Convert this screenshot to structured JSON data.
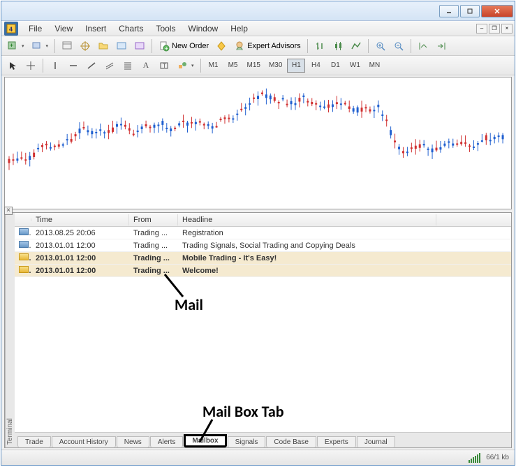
{
  "menu": {
    "items": [
      "File",
      "View",
      "Insert",
      "Charts",
      "Tools",
      "Window",
      "Help"
    ]
  },
  "toolbar": {
    "new_order": "New Order",
    "expert_advisors": "Expert Advisors"
  },
  "timeframes": [
    "M1",
    "M5",
    "M15",
    "M30",
    "H1",
    "H4",
    "D1",
    "W1",
    "MN"
  ],
  "timeframe_active": "H1",
  "mail": {
    "columns": {
      "time": "Time",
      "from": "From",
      "headline": "Headline"
    },
    "rows": [
      {
        "read": true,
        "time": "2013.08.25 20:06",
        "from": "Trading ...",
        "headline": "Registration"
      },
      {
        "read": true,
        "time": "2013.01.01 12:00",
        "from": "Trading ...",
        "headline": "Trading Signals, Social Trading and Copying Deals"
      },
      {
        "read": false,
        "time": "2013.01.01 12:00",
        "from": "Trading ...",
        "headline": "Mobile Trading - It's Easy!"
      },
      {
        "read": false,
        "time": "2013.01.01 12:00",
        "from": "Trading ...",
        "headline": "Welcome!"
      }
    ]
  },
  "tabs": [
    "Trade",
    "Account History",
    "News",
    "Alerts",
    "Mailbox",
    "Signals",
    "Code Base",
    "Experts",
    "Journal"
  ],
  "active_tab": "Mailbox",
  "terminal_label": "Terminal",
  "status": {
    "conn": "66/1 kb"
  },
  "annotations": {
    "mail": "Mail",
    "mailbox": "Mail Box Tab"
  }
}
